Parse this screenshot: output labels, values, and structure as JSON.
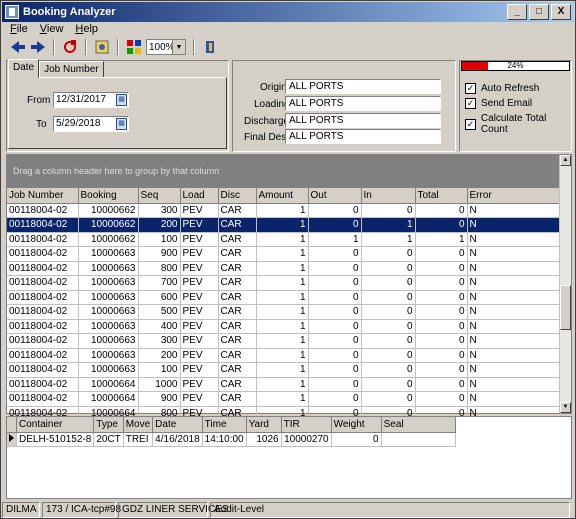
{
  "window": {
    "title": "Booking Analyzer",
    "min": "_",
    "max": "□",
    "close": "X"
  },
  "menu": [
    "File",
    "View",
    "Help"
  ],
  "menu_underline": [
    "F",
    "V",
    "H"
  ],
  "toolbar": {
    "zoom": "100%"
  },
  "tabs": [
    "Date",
    "Job Number"
  ],
  "date": {
    "from_label": "From",
    "from_value": "12/31/2017",
    "to_label": "To",
    "to_value": "5/29/2018"
  },
  "ports": [
    {
      "label": "Origin",
      "value": "ALL PORTS"
    },
    {
      "label": "Loading",
      "value": "ALL PORTS"
    },
    {
      "label": "Discharge",
      "value": "ALL PORTS"
    },
    {
      "label": "Final Dest",
      "value": "ALL PORTS"
    }
  ],
  "progress": {
    "text": "24%",
    "value": 0.24
  },
  "options": [
    {
      "label": "Auto Refresh",
      "checked": true
    },
    {
      "label": "Send Email",
      "checked": true
    },
    {
      "label": "Calculate Total Count",
      "checked": true
    }
  ],
  "grid": {
    "group_hint": "Drag a column header here to group by that column",
    "columns": [
      "Job Number",
      "Booking",
      "Seq",
      "Load",
      "Disc",
      "Amount",
      "Out",
      "In",
      "Total",
      "Error"
    ],
    "rows": [
      [
        "00118004-02",
        "10000662",
        "300",
        "PEV",
        "CAR",
        "1",
        "0",
        "0",
        "0",
        "N"
      ],
      [
        "00118004-02",
        "10000662",
        "200",
        "PEV",
        "CAR",
        "1",
        "0",
        "1",
        "0",
        "N"
      ],
      [
        "00118004-02",
        "10000662",
        "100",
        "PEV",
        "CAR",
        "1",
        "1",
        "1",
        "1",
        "N"
      ],
      [
        "00118004-02",
        "10000663",
        "900",
        "PEV",
        "CAR",
        "1",
        "0",
        "0",
        "0",
        "N"
      ],
      [
        "00118004-02",
        "10000663",
        "800",
        "PEV",
        "CAR",
        "1",
        "0",
        "0",
        "0",
        "N"
      ],
      [
        "00118004-02",
        "10000663",
        "700",
        "PEV",
        "CAR",
        "1",
        "0",
        "0",
        "0",
        "N"
      ],
      [
        "00118004-02",
        "10000663",
        "600",
        "PEV",
        "CAR",
        "1",
        "0",
        "0",
        "0",
        "N"
      ],
      [
        "00118004-02",
        "10000663",
        "500",
        "PEV",
        "CAR",
        "1",
        "0",
        "0",
        "0",
        "N"
      ],
      [
        "00118004-02",
        "10000663",
        "400",
        "PEV",
        "CAR",
        "1",
        "0",
        "0",
        "0",
        "N"
      ],
      [
        "00118004-02",
        "10000663",
        "300",
        "PEV",
        "CAR",
        "1",
        "0",
        "0",
        "0",
        "N"
      ],
      [
        "00118004-02",
        "10000663",
        "200",
        "PEV",
        "CAR",
        "1",
        "0",
        "0",
        "0",
        "N"
      ],
      [
        "00118004-02",
        "10000663",
        "100",
        "PEV",
        "CAR",
        "1",
        "0",
        "0",
        "0",
        "N"
      ],
      [
        "00118004-02",
        "10000664",
        "1000",
        "PEV",
        "CAR",
        "1",
        "0",
        "0",
        "0",
        "N"
      ],
      [
        "00118004-02",
        "10000664",
        "900",
        "PEV",
        "CAR",
        "1",
        "0",
        "0",
        "0",
        "N"
      ],
      [
        "00118004-02",
        "10000664",
        "800",
        "PEV",
        "CAR",
        "1",
        "0",
        "0",
        "0",
        "N"
      ]
    ],
    "selected_row": 1
  },
  "detail": {
    "columns": [
      "Container",
      "Type",
      "Move",
      "Date",
      "Time",
      "Yard",
      "TIR",
      "Weight",
      "Seal"
    ],
    "rows": [
      [
        "DELH-510152-8",
        "20CT",
        "TREI",
        "4/16/2018",
        "14:10:00",
        "1026",
        "10000270",
        "0",
        ""
      ]
    ]
  },
  "status": [
    "DILMA",
    "173 / ICA-tcp#98",
    "GDZ LINER SERVICES",
    "Audit-Level"
  ]
}
